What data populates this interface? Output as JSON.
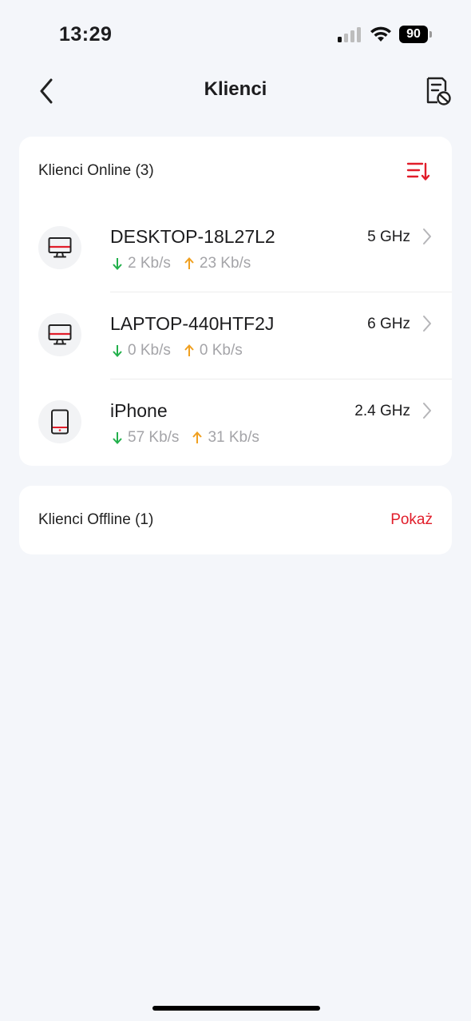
{
  "status_bar": {
    "time": "13:29",
    "battery": "90"
  },
  "nav": {
    "title": "Klienci",
    "back_icon": "chevron-left-icon",
    "action_icon": "blocklist-icon"
  },
  "online": {
    "title": "Klienci Online (3)",
    "sort_icon": "sort-icon",
    "clients": [
      {
        "name": "DESKTOP-18L27L2",
        "band": "5 GHz",
        "download": "2 Kb/s",
        "upload": "23 Kb/s",
        "device_icon": "desktop-icon"
      },
      {
        "name": "LAPTOP-440HTF2J",
        "band": "6 GHz",
        "download": "0 Kb/s",
        "upload": "0 Kb/s",
        "device_icon": "desktop-icon"
      },
      {
        "name": "iPhone",
        "band": "2.4 GHz",
        "download": "57 Kb/s",
        "upload": "31 Kb/s",
        "device_icon": "tablet-icon"
      }
    ]
  },
  "offline": {
    "title": "Klienci Offline (1)",
    "show_label": "Pokaż"
  },
  "colors": {
    "accent": "#e11d2a",
    "download": "#22b04b",
    "upload": "#f0a020",
    "background": "#f4f6fa"
  }
}
